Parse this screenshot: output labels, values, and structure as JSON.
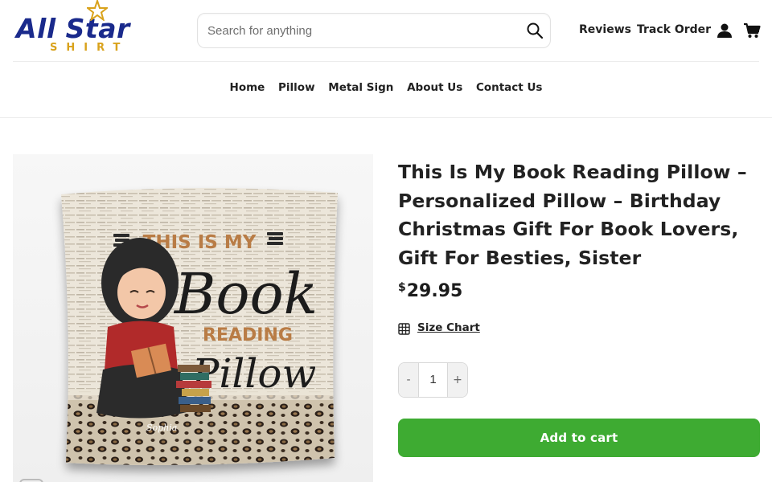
{
  "brand": {
    "logo_main": "All Star",
    "logo_sub": "SHIRT",
    "colors": {
      "primary": "#1a2a8c",
      "gold": "#d9a21b"
    }
  },
  "search": {
    "placeholder": "Search for anything",
    "value": ""
  },
  "header_links": {
    "reviews": "Reviews",
    "track_order": "Track Order"
  },
  "icons": {
    "search": "search-icon",
    "user": "user-icon",
    "cart": "cart-icon",
    "size_chart": "table-grid-icon"
  },
  "nav": {
    "items": [
      {
        "label": "Home"
      },
      {
        "label": "Pillow"
      },
      {
        "label": "Metal Sign"
      },
      {
        "label": "About Us"
      },
      {
        "label": "Contact Us"
      }
    ]
  },
  "product": {
    "title": "This Is My Book Reading Pillow – Personalized Pillow – Birthday Christmas Gift For Book Lovers, Gift For Besties, Sister",
    "currency": "$",
    "price": "29.95",
    "size_chart_label": "Size Chart",
    "quantity": {
      "minus": "-",
      "value": "1",
      "plus": "+"
    },
    "add_to_cart_label": "Add to cart",
    "image": {
      "line1": "THIS IS MY",
      "line2": "Book",
      "line3": "READING",
      "line4": "Pillow",
      "name": "Sophia"
    },
    "colors": {
      "add_to_cart": "#3eab32"
    }
  }
}
